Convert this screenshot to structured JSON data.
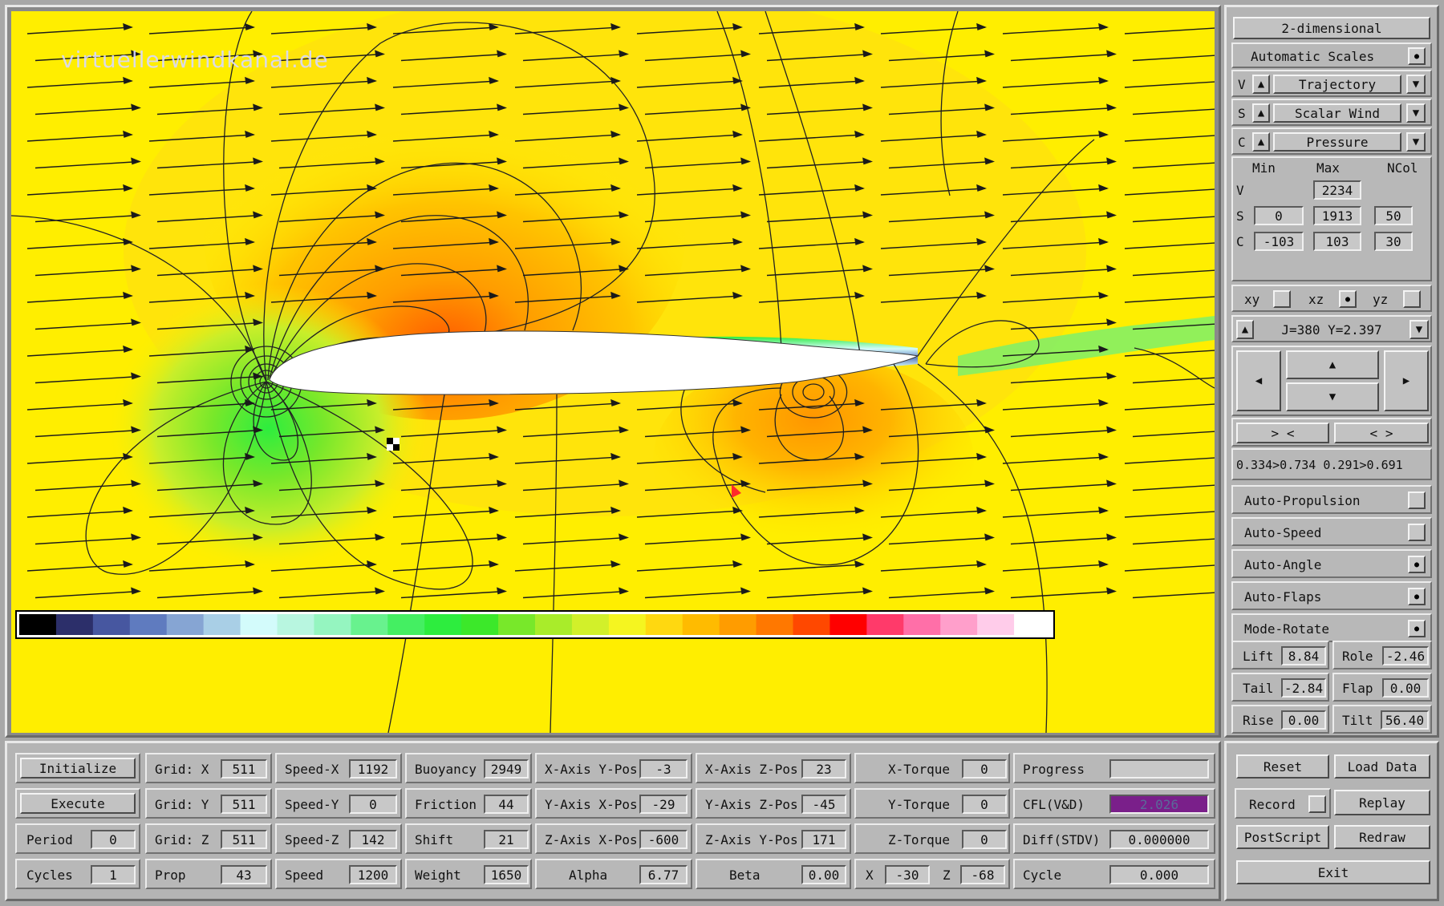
{
  "watermark": "virtuellerwindkanal.de",
  "colorbar": [
    "#000000",
    "#2c2f6a",
    "#4757a0",
    "#5f7bbf",
    "#86a5d3",
    "#a9cfe6",
    "#d3fbfb",
    "#b8f6e0",
    "#95f5c0",
    "#68f28e",
    "#44ef62",
    "#2ded3e",
    "#3ce82a",
    "#78e82a",
    "#a9ec2a",
    "#d2f02a",
    "#f5f520",
    "#ffd810",
    "#ffbb00",
    "#ff9c00",
    "#ff7800",
    "#ff4800",
    "#ff0000",
    "#ff3a6a",
    "#ff6fa8",
    "#ff9fcb",
    "#ffccea",
    "#ffffff"
  ],
  "colors": {
    "field": "#ffee00",
    "arrow": "#1a1a1a",
    "contour": "#222222",
    "cfl": "#7a1f8a"
  },
  "right": {
    "mode": "2-dimensional",
    "auto_scales": "Automatic Scales",
    "v_sel": {
      "letter": "V",
      "value": "Trajectory"
    },
    "s_sel": {
      "letter": "S",
      "value": "Scalar Wind"
    },
    "c_sel": {
      "letter": "C",
      "value": "Pressure"
    },
    "hdr_min": "Min",
    "hdr_max": "Max",
    "hdr_ncol": "NCol",
    "row_v": {
      "letter": "V",
      "max": "2234"
    },
    "row_s": {
      "letter": "S",
      "min": "0",
      "max": "1913",
      "ncol": "50"
    },
    "row_c": {
      "letter": "C",
      "min": "-103",
      "max": "103",
      "ncol": "30"
    },
    "planes": {
      "xy": "xy",
      "xz": "xz",
      "yz": "yz"
    },
    "slice": "J=380  Y=2.397",
    "shrink": "> <",
    "expand": "< >",
    "range": "0.334>0.734 0.291>0.691",
    "toggles": [
      "Auto-Propulsion",
      "Auto-Speed",
      "Auto-Angle",
      "Auto-Flaps",
      "Mode-Rotate"
    ],
    "lift": {
      "label": "Lift",
      "value": "8.84"
    },
    "role": {
      "label": "Role",
      "value": "-2.46"
    },
    "tail": {
      "label": "Tail",
      "value": "-2.84"
    },
    "flap": {
      "label": "Flap",
      "value": "0.00"
    },
    "rise": {
      "label": "Rise",
      "value": "0.00"
    },
    "tilt": {
      "label": "Tilt",
      "value": "56.40"
    }
  },
  "bottom": {
    "initialize": "Initialize",
    "execute": "Execute",
    "period": {
      "label": "Period",
      "value": "0"
    },
    "cycles": {
      "label": "Cycles",
      "value": "1"
    },
    "grid_x": {
      "label": "Grid: X",
      "value": "511"
    },
    "grid_y": {
      "label": "Grid: Y",
      "value": "511"
    },
    "grid_z": {
      "label": "Grid: Z",
      "value": "511"
    },
    "prop": {
      "label": "Prop",
      "value": "43"
    },
    "speed_x": {
      "label": "Speed-X",
      "value": "1192"
    },
    "speed_y": {
      "label": "Speed-Y",
      "value": "0"
    },
    "speed_z": {
      "label": "Speed-Z",
      "value": "142"
    },
    "speed": {
      "label": "Speed",
      "value": "1200"
    },
    "buoyancy": {
      "label": "Buoyancy",
      "value": "2949"
    },
    "friction": {
      "label": "Friction",
      "value": "44"
    },
    "shift": {
      "label": "Shift",
      "value": "21"
    },
    "weight": {
      "label": "Weight",
      "value": "1650"
    },
    "xaxis_ypos": {
      "label": "X-Axis Y-Pos",
      "value": "-3"
    },
    "yaxis_xpos": {
      "label": "Y-Axis X-Pos",
      "value": "-29"
    },
    "zaxis_xpos": {
      "label": "Z-Axis X-Pos",
      "value": "-600"
    },
    "alpha": {
      "label": "Alpha",
      "value": "6.77"
    },
    "xaxis_zpos": {
      "label": "X-Axis Z-Pos",
      "value": "23"
    },
    "yaxis_zpos": {
      "label": "Y-Axis Z-Pos",
      "value": "-45"
    },
    "zaxis_ypos": {
      "label": "Z-Axis Y-Pos",
      "value": "171"
    },
    "beta": {
      "label": "Beta",
      "value": "0.00"
    },
    "x_torque": {
      "label": "X-Torque",
      "value": "0"
    },
    "y_torque": {
      "label": "Y-Torque",
      "value": "0"
    },
    "z_torque": {
      "label": "Z-Torque",
      "value": "0"
    },
    "x": {
      "label": "X",
      "value": "-30"
    },
    "z": {
      "label": "Z",
      "value": "-68"
    },
    "progress": {
      "label": "Progress",
      "value": ""
    },
    "cfl": {
      "label": "CFL(V&D)",
      "value": "2.026"
    },
    "diff": {
      "label": "Diff(STDV)",
      "value": "0.000000"
    },
    "cycle": {
      "label": "Cycle",
      "value": "0.000"
    }
  },
  "br": {
    "reset": "Reset",
    "load": "Load Data",
    "record": "Record",
    "replay": "Replay",
    "postscript": "PostScript",
    "redraw": "Redraw",
    "exit": "Exit"
  }
}
